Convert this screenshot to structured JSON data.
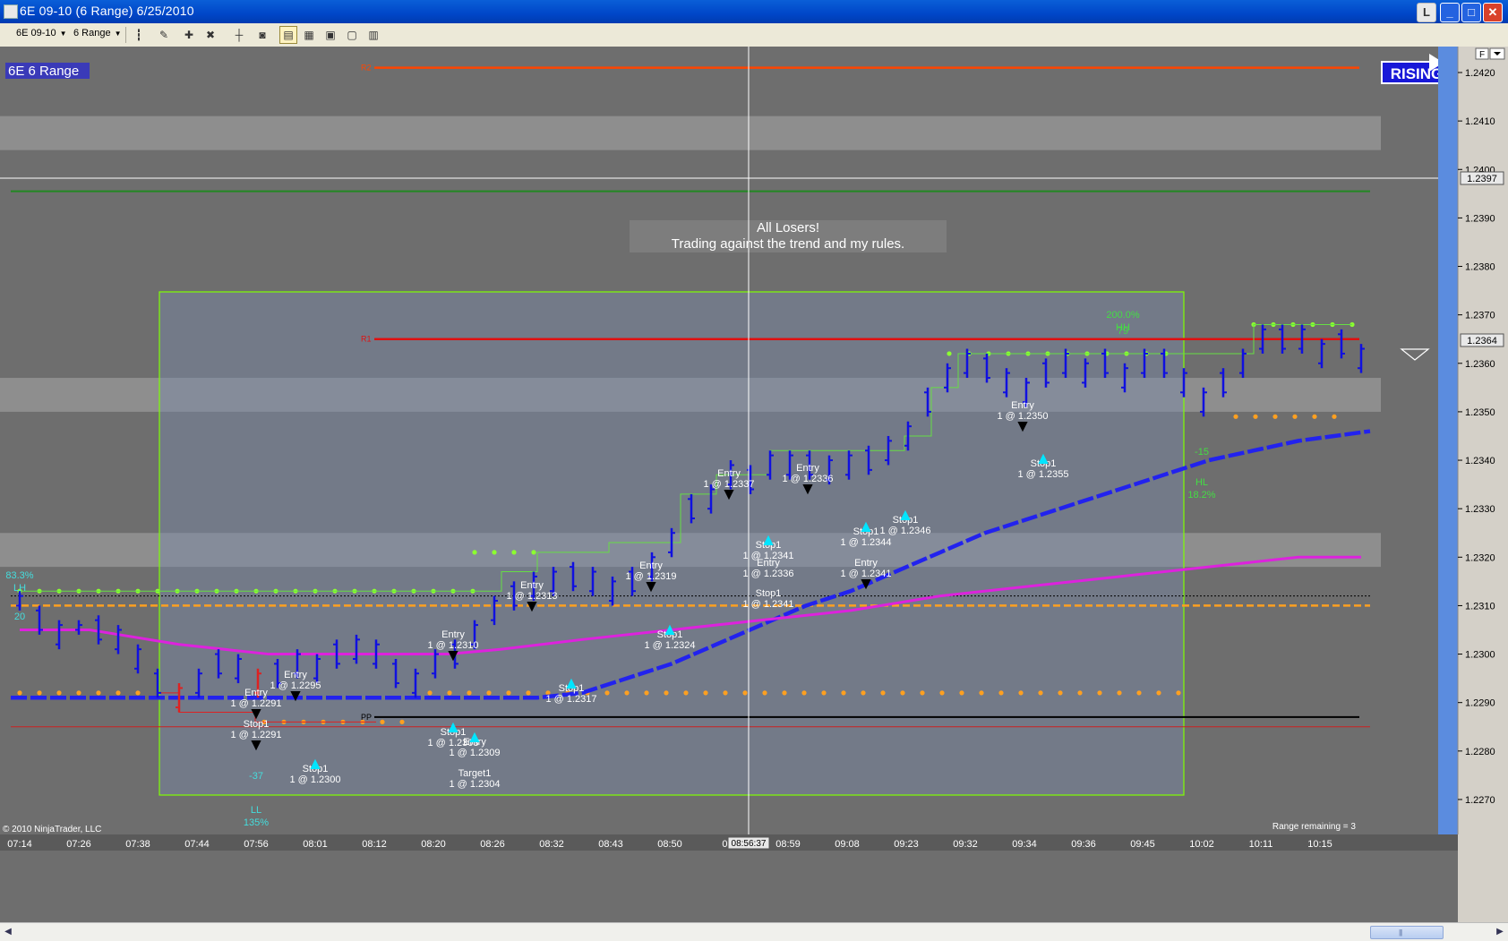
{
  "window": {
    "title": "6E 09-10 (6 Range)  6/25/2010",
    "buttons": {
      "l": "L",
      "minimize": "_",
      "maximize": "□",
      "close": "✕"
    }
  },
  "toolbar": {
    "instrument": "6E 09-10",
    "period": "6 Range",
    "icons": [
      "bars-type-icon",
      "draw-pencil-icon",
      "zoom-in-icon",
      "zoom-out-icon",
      "crosshair-icon",
      "snapshot-icon",
      "strategy-icon",
      "indicators-icon",
      "chart-properties-icon",
      "properties-icon",
      "data-box-icon"
    ]
  },
  "chart_header": {
    "label": "6E 6 Range",
    "badge": "RISING",
    "note_line1": "All Losers!",
    "note_line2": "Trading against the trend and my rules.",
    "copyright": "© 2010 NinjaTrader, LLC",
    "range_remaining": "Range remaining = 3",
    "crosshair_time": "08:56:37",
    "crosshair_price": "1.2397",
    "last_price": "1.2364"
  },
  "chart_data": {
    "type": "bar",
    "instrument": "6E 09-10",
    "bar_type": "6 Range",
    "date": "6/25/2010",
    "y_ticks": [
      "1.2420",
      "1.2410",
      "1.2400",
      "1.2390",
      "1.2380",
      "1.2370",
      "1.2360",
      "1.2350",
      "1.2340",
      "1.2330",
      "1.2320",
      "1.2310",
      "1.2300",
      "1.2290",
      "1.2280",
      "1.2270"
    ],
    "x_ticks": [
      "07:14",
      "07:26",
      "07:38",
      "07:44",
      "07:56",
      "08:01",
      "08:12",
      "08:20",
      "08:26",
      "08:32",
      "08:43",
      "08:50",
      "08:",
      "08:59",
      "09:08",
      "09:23",
      "09:32",
      "09:34",
      "09:36",
      "09:45",
      "10:02",
      "10:11",
      "10:15"
    ],
    "ylim": [
      1.2265,
      1.2425
    ],
    "pivot_lines": [
      {
        "label": "R2",
        "value": 1.2421,
        "color": "#ff4500"
      },
      {
        "label": "R1",
        "value": 1.2365,
        "color": "#e01010"
      },
      {
        "label": "PP",
        "value": 1.2287,
        "color": "#000000"
      }
    ],
    "zones": [
      {
        "from": 1.2404,
        "to": 1.2411
      },
      {
        "from": 1.235,
        "to": 1.2357
      },
      {
        "from": 1.2318,
        "to": 1.2325
      }
    ],
    "swing_labels": [
      {
        "text": "83.3%",
        "sub": "LH",
        "value": 1.232
      },
      {
        "text": "20",
        "value": 1.2313
      },
      {
        "text": "-37",
        "value": 1.2283
      },
      {
        "text": "LL",
        "sub": "135%",
        "value": 1.2276
      },
      {
        "text": "200.0%",
        "sub": "HH",
        "value": 1.2373
      },
      {
        "text": "79",
        "value": 1.2366
      },
      {
        "text": "-15",
        "value": 1.2347
      },
      {
        "text": "HL",
        "sub": "18.2%",
        "value": 1.2339
      }
    ],
    "trades": [
      {
        "label": "Entry",
        "detail": "1 @ 1.2295"
      },
      {
        "label": "Entry",
        "detail": "1 @ 1.2291"
      },
      {
        "label": "Stop1",
        "detail": "1 @ 1.2291"
      },
      {
        "label": "Stop1",
        "detail": "1 @ 1.2300"
      },
      {
        "label": "Entry",
        "detail": "1 @ 1.2310"
      },
      {
        "label": "Stop1",
        "detail": "1 @ 1.2303"
      },
      {
        "label": "Entry",
        "detail": "1 @ 1.2309"
      },
      {
        "label": "Target1",
        "detail": "1 @ 1.2304"
      },
      {
        "label": "Entry",
        "detail": "1 @ 1.2313"
      },
      {
        "label": "Stop1",
        "detail": "1 @ 1.2317"
      },
      {
        "label": "Entry",
        "detail": "1 @ 1.2319"
      },
      {
        "label": "Stop1",
        "detail": "1 @ 1.2324"
      },
      {
        "label": "Entry",
        "detail": "1 @ 1.2337"
      },
      {
        "label": "Stop1",
        "detail": "1 @ 1.2341"
      },
      {
        "label": "Entry",
        "detail": "1 @ 1.2336"
      },
      {
        "label": "Stop1",
        "detail": "1 @ 1.2341"
      },
      {
        "label": "Entry",
        "detail": "1 @ 1.2336"
      },
      {
        "label": "Stop1",
        "detail": "1 @ 1.2344"
      },
      {
        "label": "Entry",
        "detail": "1 @ 1.2341"
      },
      {
        "label": "Stop1",
        "detail": "1 @ 1.2346"
      },
      {
        "label": "Entry",
        "detail": "1 @ 1.2350"
      },
      {
        "label": "Stop1",
        "detail": "1 @ 1.2355"
      }
    ],
    "colors": {
      "background": "#6e6e6e",
      "bars": "#1010e0",
      "ma_fast": "#2222ee",
      "ma_slow": "#dd22dd",
      "selection_box": "#7fff00",
      "level_green_dots": "#8cff30",
      "level_orange": "#ffa020"
    }
  }
}
